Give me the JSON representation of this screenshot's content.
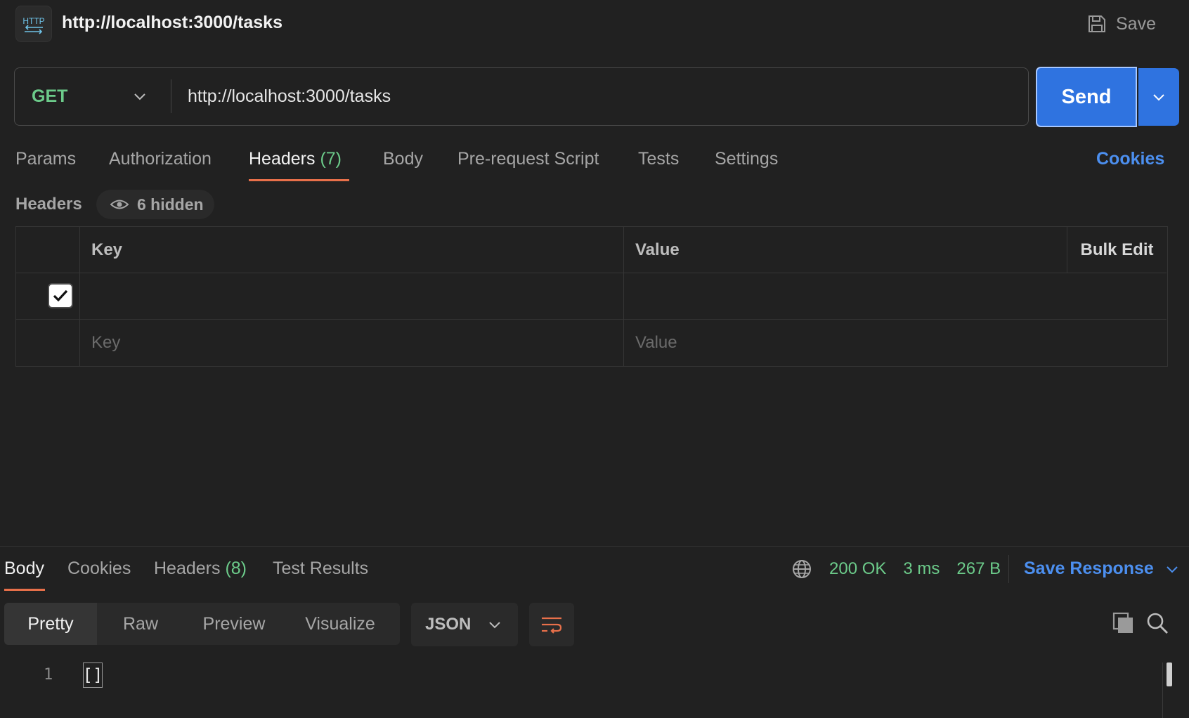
{
  "title_bar": {
    "badge_text": "HTTP",
    "title": "http://localhost:3000/tasks",
    "save_label": "Save"
  },
  "request": {
    "method": "GET",
    "url": "http://localhost:3000/tasks",
    "send_label": "Send"
  },
  "request_tabs": [
    {
      "label": "Params",
      "count": ""
    },
    {
      "label": "Authorization",
      "count": ""
    },
    {
      "label": "Headers",
      "count": "(7)"
    },
    {
      "label": "Body",
      "count": ""
    },
    {
      "label": "Pre-request Script",
      "count": ""
    },
    {
      "label": "Tests",
      "count": ""
    },
    {
      "label": "Settings",
      "count": ""
    }
  ],
  "cookies_link": "Cookies",
  "headers_section": {
    "label": "Headers",
    "hidden_label": "6 hidden",
    "table": {
      "key_header": "Key",
      "value_header": "Value",
      "bulk_edit_label": "Bulk Edit",
      "key_placeholder": "Key",
      "value_placeholder": "Value"
    }
  },
  "response_tabs": [
    {
      "label": "Body",
      "count": ""
    },
    {
      "label": "Cookies",
      "count": ""
    },
    {
      "label": "Headers",
      "count": "(8)"
    },
    {
      "label": "Test Results",
      "count": ""
    }
  ],
  "response_status": {
    "status": "200 OK",
    "time": "3 ms",
    "size": "267 B",
    "save_response_label": "Save Response"
  },
  "response_view": {
    "modes": [
      "Pretty",
      "Raw",
      "Preview",
      "Visualize"
    ],
    "format": "JSON"
  },
  "response_body": {
    "line_number": "1",
    "content": "[]"
  },
  "colors": {
    "background": "#212121",
    "accent_blue": "#2f73e0",
    "link_blue": "#4c8fef",
    "success_green": "#6ccb8a",
    "active_underline": "#e8704a"
  }
}
